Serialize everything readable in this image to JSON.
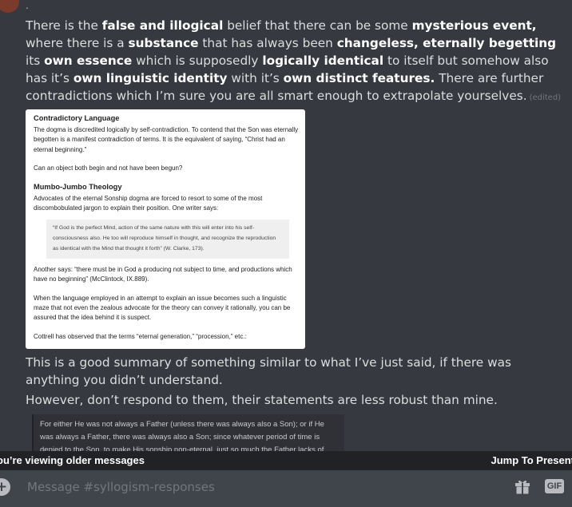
{
  "top_marker": ".",
  "message1": {
    "segments": [
      {
        "t": "There is the ",
        "b": false
      },
      {
        "t": "false and illogical",
        "b": true
      },
      {
        "t": " belief that there can be some ",
        "b": false
      },
      {
        "t": "mysterious event,",
        "b": true
      },
      {
        "t": " where there is a ",
        "b": false
      },
      {
        "t": "substance",
        "b": true
      },
      {
        "t": " that has always been ",
        "b": false
      },
      {
        "t": "changeless, eternally begetting",
        "b": true
      },
      {
        "t": " its ",
        "b": false
      },
      {
        "t": "own essence",
        "b": true
      },
      {
        "t": " which is supposedly ",
        "b": false
      },
      {
        "t": "logically identical",
        "b": true
      },
      {
        "t": " to itself but somehow also has it’s ",
        "b": false
      },
      {
        "t": "own linguistic identity",
        "b": true
      },
      {
        "t": " with it’s ",
        "b": false
      },
      {
        "t": "own distinct features.",
        "b": true
      },
      {
        "t": " There are further contradictions which I’m sure you are all smart enough to extrapolate yourselves.",
        "b": false
      }
    ],
    "edited_label": "(edited)"
  },
  "doc_image": {
    "heading1": "Contradictory Language",
    "para1": "The dogma is discredited logically by self-contradiction. To contend that the Son was eternally begotten is a manifest contradiction of terms. It is the equivalent of saying, “Christ had an eternal beginning.”",
    "para2": "Can an object both begin and not have been begun?",
    "heading2": "Mumbo-Jumbo Theology",
    "para3": "Advocates of the eternal Sonship dogma are forced to resort to some of the most discombobulated jargon to explain their position. One writer says:",
    "quote": "“If God is the perfect Mind, action of the same nature with this will enter into his self-consciousness also. He too will reproduce himself in thought, and recognize the reproduction as identical with the Mind that thought it forth” (W. Clarke, 173).",
    "para4": "Another says: “there must be in God a producing not subject to time, and productions which have no beginning” (McClintock, IX.889).",
    "para5": "When the language employed in an attempt to explain an issue becomes such a linguistic maze that not even the zealous advocate for the theory can convey it rationally, you can be assured that the idea behind it is suspect.",
    "para6": "Cottrell has observed that the terms “eternal generation,” “procession,” etc.:"
  },
  "message2": "This is a good summary of something similar to what I’ve just said, if there was anything you didn’t understand.",
  "message3": "However, don’t respond to them, their statements are less robust than mine.",
  "dark_image": {
    "text": "For either He was not always a Father (unless there was always also a Son); or if He was always a Father, there was always also a Son; since whatever period of time is denied to the Son, to make His sonship non-eternal, just so much the Father lacks of having been"
  },
  "older_bar": {
    "left_text": "ou’re viewing older messages",
    "right_text": "Jump To Present"
  },
  "composer": {
    "placeholder": "Message #syllogism-responses",
    "add_icon": "plus-circle-icon",
    "gift_icon": "gift-icon",
    "gif_label": "GIF"
  },
  "colors": {
    "background": "#36393f",
    "bar": "#202225",
    "composer": "#40444b",
    "text": "#dcddde",
    "muted": "#72767d"
  }
}
